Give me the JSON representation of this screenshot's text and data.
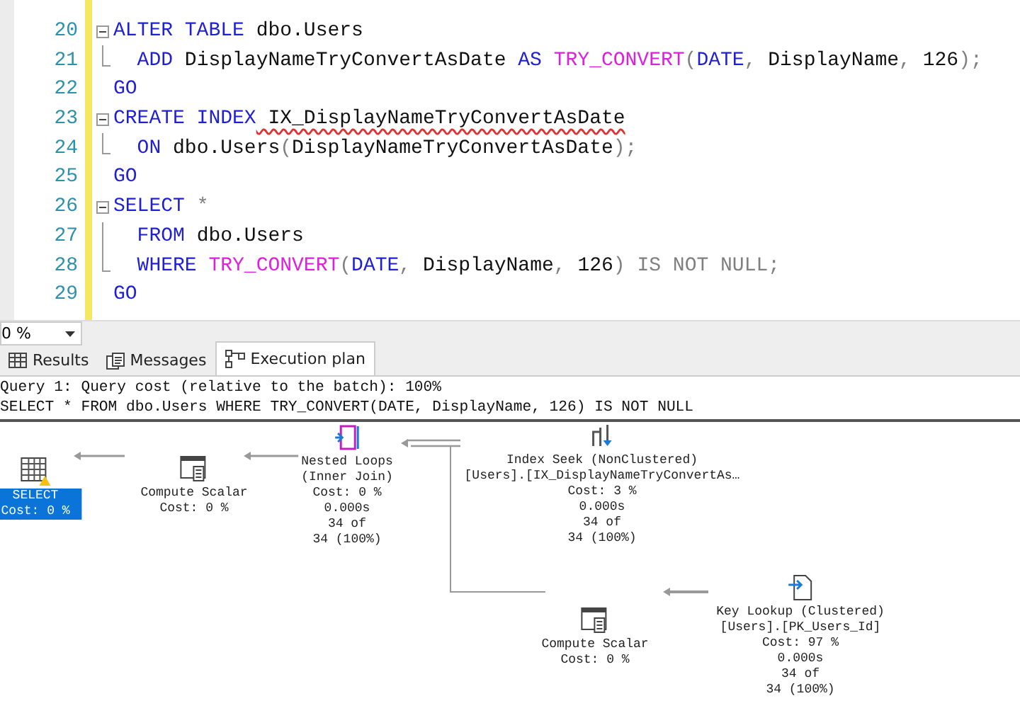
{
  "editor": {
    "lines": [
      {
        "number": "20",
        "kind": "fold-start",
        "tokens": [
          {
            "kind": "keyword",
            "text": "ALTER TABLE"
          },
          {
            "kind": "plain",
            "text": " dbo.Users"
          }
        ]
      },
      {
        "number": "21",
        "kind": "fold-end",
        "tokens": [
          {
            "kind": "keyword",
            "text": "  ADD"
          },
          {
            "kind": "plain",
            "text": " DisplayNameTryConvertAsDate "
          },
          {
            "kind": "keyword",
            "text": "AS"
          },
          {
            "kind": "function",
            "text": " TRY_CONVERT"
          },
          {
            "kind": "operator",
            "text": "("
          },
          {
            "kind": "keyword",
            "text": "DATE"
          },
          {
            "kind": "operator",
            "text": ","
          },
          {
            "kind": "plain",
            "text": " DisplayName"
          },
          {
            "kind": "operator",
            "text": ","
          },
          {
            "kind": "plain",
            "text": " 126"
          },
          {
            "kind": "operator",
            "text": ");"
          }
        ]
      },
      {
        "number": "22",
        "kind": "plain",
        "tokens": [
          {
            "kind": "keyword",
            "text": "GO"
          }
        ]
      },
      {
        "number": "23",
        "kind": "fold-start",
        "tokens": [
          {
            "kind": "keyword",
            "text": "CREATE INDEX"
          },
          {
            "kind": "error",
            "text": " IX_DisplayNameTryConvertAsDate"
          }
        ]
      },
      {
        "number": "24",
        "kind": "fold-end",
        "tokens": [
          {
            "kind": "keyword",
            "text": "  ON"
          },
          {
            "kind": "plain",
            "text": " dbo.Users"
          },
          {
            "kind": "operator",
            "text": "("
          },
          {
            "kind": "plain",
            "text": "DisplayNameTryConvertAsDate"
          },
          {
            "kind": "operator",
            "text": ");"
          }
        ]
      },
      {
        "number": "25",
        "kind": "plain",
        "tokens": [
          {
            "kind": "keyword",
            "text": "GO"
          }
        ]
      },
      {
        "number": "26",
        "kind": "fold-start",
        "tokens": [
          {
            "kind": "keyword",
            "text": "SELECT"
          },
          {
            "kind": "operator",
            "text": " *"
          }
        ]
      },
      {
        "number": "27",
        "kind": "fold-body",
        "tokens": [
          {
            "kind": "keyword",
            "text": "  FROM"
          },
          {
            "kind": "plain",
            "text": " dbo.Users"
          }
        ]
      },
      {
        "number": "28",
        "kind": "fold-end",
        "tokens": [
          {
            "kind": "keyword",
            "text": "  WHERE"
          },
          {
            "kind": "function",
            "text": " TRY_CONVERT"
          },
          {
            "kind": "operator",
            "text": "("
          },
          {
            "kind": "keyword",
            "text": "DATE"
          },
          {
            "kind": "operator",
            "text": ","
          },
          {
            "kind": "plain",
            "text": " DisplayName"
          },
          {
            "kind": "operator",
            "text": ","
          },
          {
            "kind": "plain",
            "text": " 126"
          },
          {
            "kind": "operator",
            "text": ") IS NOT NULL;"
          }
        ]
      },
      {
        "number": "29",
        "kind": "plain",
        "tokens": [
          {
            "kind": "keyword",
            "text": "GO"
          }
        ]
      }
    ]
  },
  "zoom": {
    "value": "0 %"
  },
  "tabs": [
    {
      "label": "Results",
      "kind": "results",
      "selected": false
    },
    {
      "label": "Messages",
      "kind": "messages",
      "selected": false
    },
    {
      "label": "Execution plan",
      "kind": "plan",
      "selected": true
    }
  ],
  "plan": {
    "header": [
      "Query 1: Query cost (relative to the batch): 100%",
      "SELECT * FROM dbo.Users WHERE TRY_CONVERT(DATE, DisplayName, 126) IS NOT NULL"
    ],
    "nodes": [
      {
        "kind": "select",
        "selected": true,
        "warning": true,
        "lines": [
          "SELECT",
          "Cost: 0 %"
        ]
      },
      {
        "kind": "compute",
        "selected": false,
        "warning": false,
        "lines": [
          "Compute Scalar",
          "Cost: 0 %"
        ]
      },
      {
        "kind": "nested",
        "selected": false,
        "warning": false,
        "lines": [
          "Nested Loops",
          "(Inner Join)",
          "Cost: 0 %",
          "0.000s",
          "34 of",
          "34 (100%)"
        ]
      },
      {
        "kind": "seek",
        "selected": false,
        "warning": false,
        "lines": [
          "Index Seek (NonClustered)",
          "[Users].[IX_DisplayNameTryConvertAs…",
          "Cost: 3 %",
          "0.000s",
          "34 of",
          "34 (100%)"
        ]
      },
      {
        "kind": "compute",
        "selected": false,
        "warning": false,
        "lines": [
          "Compute Scalar",
          "Cost: 0 %"
        ]
      },
      {
        "kind": "lookup",
        "selected": false,
        "warning": false,
        "lines": [
          "Key Lookup (Clustered)",
          "[Users].[PK_Users_Id]",
          "Cost: 97 %",
          "0.000s",
          "34 of",
          "34 (100%)"
        ]
      }
    ]
  }
}
